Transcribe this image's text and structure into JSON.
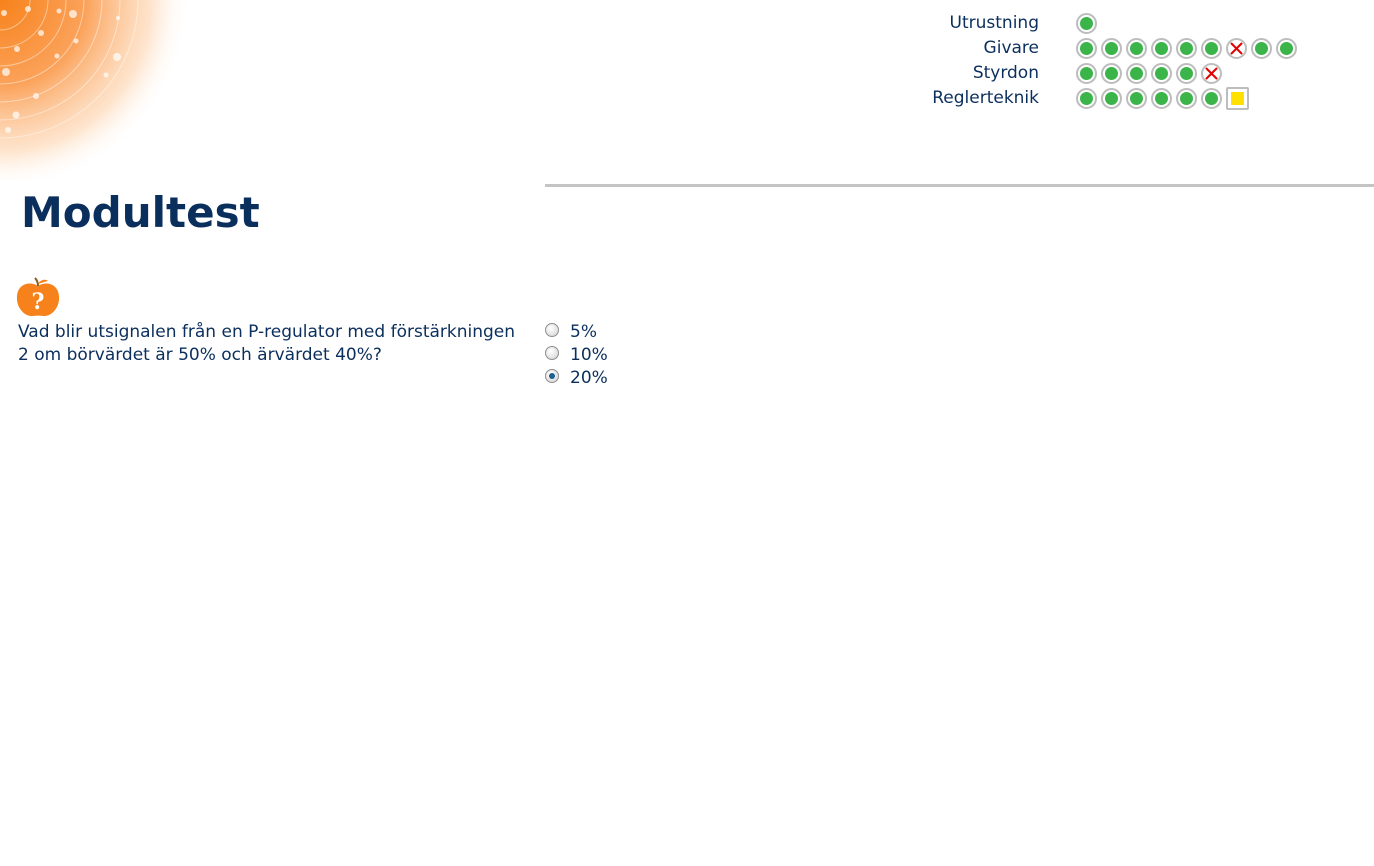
{
  "header": {
    "title": "Modultest"
  },
  "progress": {
    "rows": [
      {
        "label": "Utrustning",
        "marks": [
          "done"
        ]
      },
      {
        "label": "Givare",
        "marks": [
          "done",
          "done",
          "done",
          "done",
          "done",
          "done",
          "wrong",
          "done",
          "done"
        ]
      },
      {
        "label": "Styrdon",
        "marks": [
          "done",
          "done",
          "done",
          "done",
          "done",
          "wrong"
        ]
      },
      {
        "label": "Reglerteknik",
        "marks": [
          "done",
          "done",
          "done",
          "done",
          "done",
          "done",
          "current"
        ]
      }
    ],
    "mark_colors": {
      "done": "#3bb54a",
      "wrong": "#e00000",
      "current": "#ffe000"
    }
  },
  "question": {
    "icon": "apple-question-icon",
    "text": "Vad blir utsignalen från en P-regulator med förstärkningen 2 om börvärdet är 50% och ärvärdet 40%?",
    "options": [
      {
        "label": "5%",
        "selected": false
      },
      {
        "label": "10%",
        "selected": false
      },
      {
        "label": "20%",
        "selected": true
      }
    ]
  },
  "colors": {
    "text": "#0b2f5c",
    "accent": "#f7821b",
    "divider": "#c4c4c4"
  }
}
